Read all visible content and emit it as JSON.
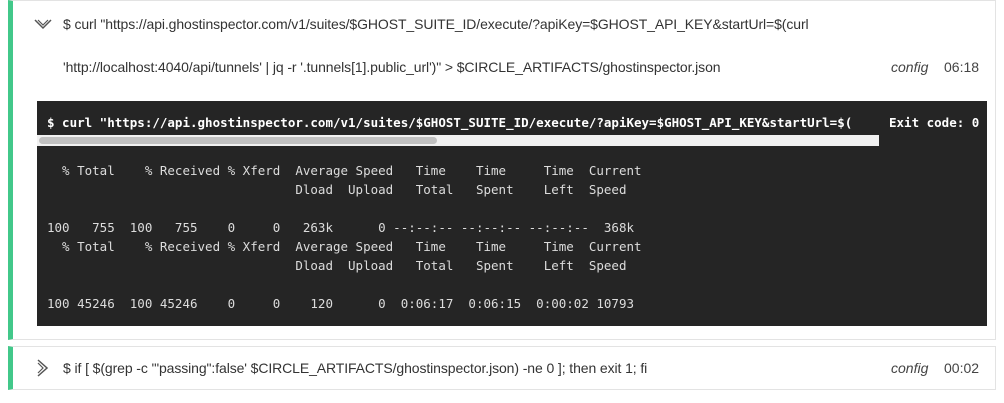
{
  "steps": [
    {
      "command_line1": "$ curl \"https://api.ghostinspector.com/v1/suites/$GHOST_SUITE_ID/execute/?apiKey=$GHOST_API_KEY&startUrl=$(curl",
      "command_line2": "'http://localhost:4040/api/tunnels' | jq -r '.tunnels[1].public_url')\" > $CIRCLE_ARTIFACTS/ghostinspector.json",
      "meta_label": "config",
      "duration": "06:18",
      "expanded": true,
      "icon": "chevron-down-icon",
      "terminal": {
        "command": "$ curl \"https://api.ghostinspector.com/v1/suites/$GHOST_SUITE_ID/execute/?apiKey=$GHOST_API_KEY&startUrl=$(",
        "exit_code": "Exit code: 0",
        "output": "  % Total    % Received % Xferd  Average Speed   Time    Time     Time  Current\n                                 Dload  Upload   Total   Spent    Left  Speed\n\n100   755  100   755    0     0   263k      0 --:--:-- --:--:-- --:--:--  368k\n  % Total    % Received % Xferd  Average Speed   Time    Time     Time  Current\n                                 Dload  Upload   Total   Spent    Left  Speed\n\n100 45246  100 45246    0     0    120      0  0:06:17  0:06:15  0:00:02 10793"
      }
    },
    {
      "command_line1": "$ if [ $(grep -c '\"passing\":false' $CIRCLE_ARTIFACTS/ghostinspector.json) -ne 0 ]; then exit 1; fi",
      "meta_label": "config",
      "duration": "00:02",
      "expanded": false,
      "icon": "chevron-right-icon"
    }
  ],
  "colors": {
    "success_accent": "#42c88a",
    "terminal_bg": "#252525"
  }
}
